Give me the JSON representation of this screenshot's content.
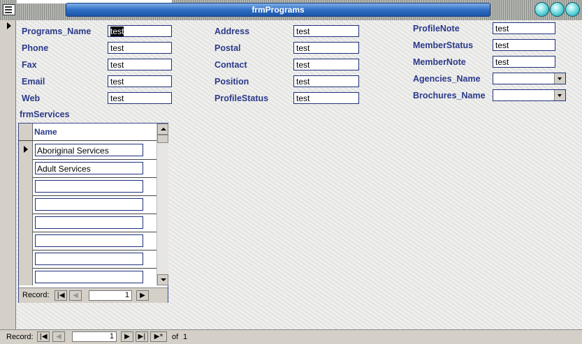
{
  "window": {
    "title": "frmPrograms"
  },
  "form": {
    "col1": [
      {
        "label": "Programs_Name",
        "value": "test"
      },
      {
        "label": "Phone",
        "value": "test"
      },
      {
        "label": "Fax",
        "value": "test"
      },
      {
        "label": "Email",
        "value": "test"
      },
      {
        "label": "Web",
        "value": "test"
      }
    ],
    "col2": [
      {
        "label": "Address",
        "value": "test"
      },
      {
        "label": "Postal",
        "value": "test"
      },
      {
        "label": "Contact",
        "value": "test"
      },
      {
        "label": "Position",
        "value": "test"
      },
      {
        "label": "ProfileStatus",
        "value": "test"
      }
    ],
    "col3": [
      {
        "label": "ProfileNote",
        "value": "test"
      },
      {
        "label": "MemberStatus",
        "value": "test"
      },
      {
        "label": "MemberNote",
        "value": "test"
      },
      {
        "label": "Agencies_Name",
        "value": ""
      },
      {
        "label": "Brochures_Name",
        "value": ""
      }
    ]
  },
  "subform": {
    "title": "frmServices",
    "column_header": "Name",
    "rows": [
      "Aboriginal Services",
      "Adult Services",
      "",
      "",
      "",
      "",
      "",
      ""
    ],
    "nav": {
      "label": "Record:",
      "current": "1"
    }
  },
  "nav": {
    "label": "Record:",
    "current": "1",
    "of_label": "of",
    "total": "1"
  }
}
